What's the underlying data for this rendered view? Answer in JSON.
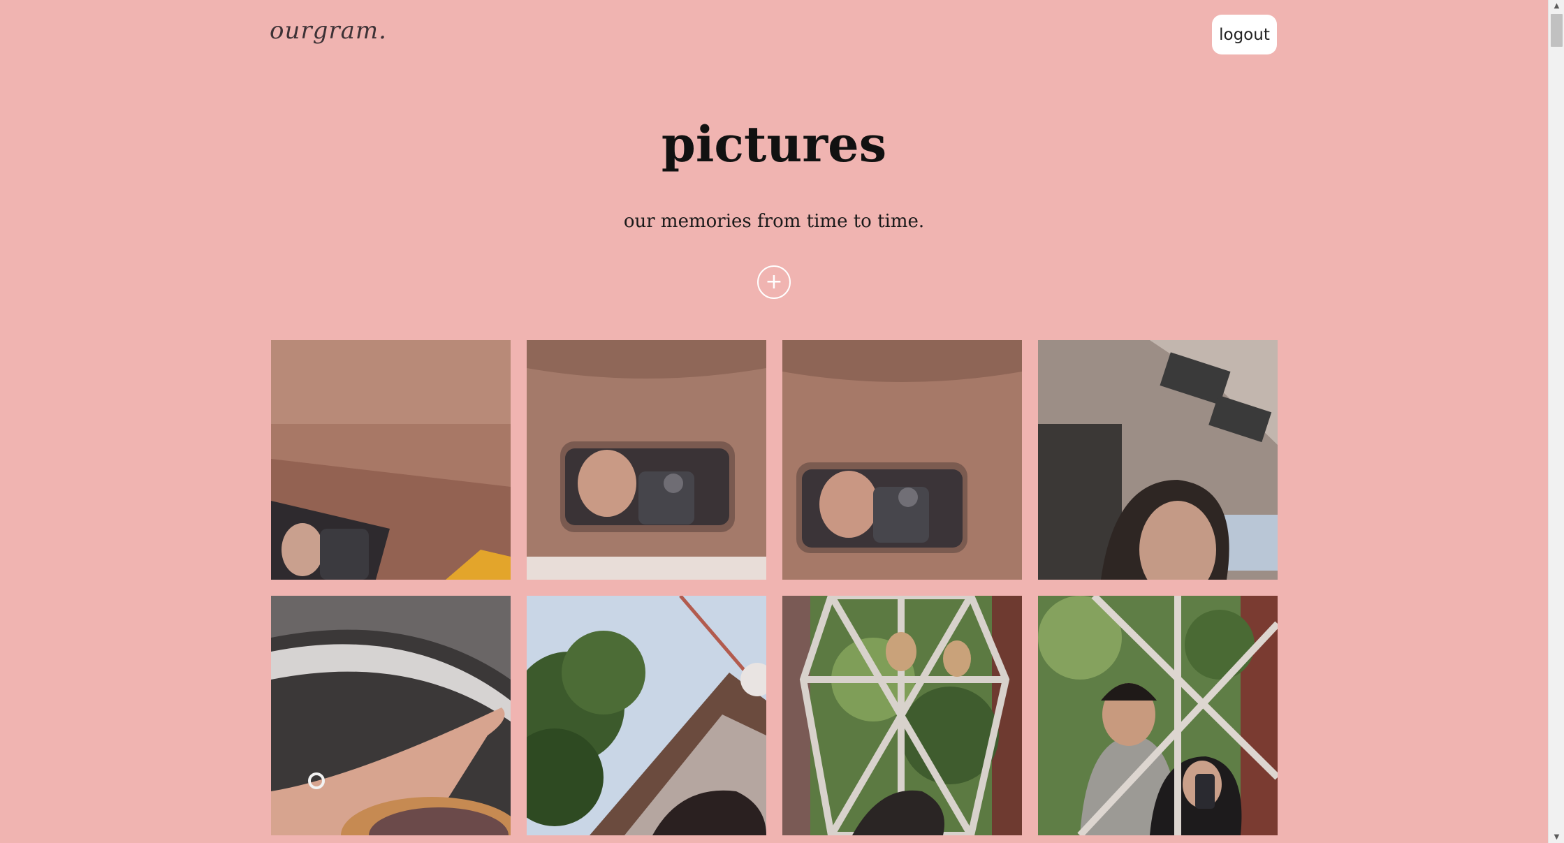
{
  "header": {
    "logo": "ourgram.",
    "logout_label": "logout"
  },
  "hero": {
    "title": "pictures",
    "subtitle": "our memories from time to time.",
    "add_icon": "plus-icon",
    "add_label": "+"
  },
  "photos": [
    {
      "subject": "car sun visor mirror selfie"
    },
    {
      "subject": "car sun visor mirror selfie"
    },
    {
      "subject": "car sun visor mirror selfie"
    },
    {
      "subject": "car interior selfie"
    },
    {
      "subject": "hand with ring holding cup"
    },
    {
      "subject": "trees and building against sky"
    },
    {
      "subject": "cafe window mirror with plants"
    },
    {
      "subject": "couple mirror selfie through window"
    }
  ],
  "colors": {
    "background": "#f0b4b1",
    "button_bg": "#ffffff"
  }
}
